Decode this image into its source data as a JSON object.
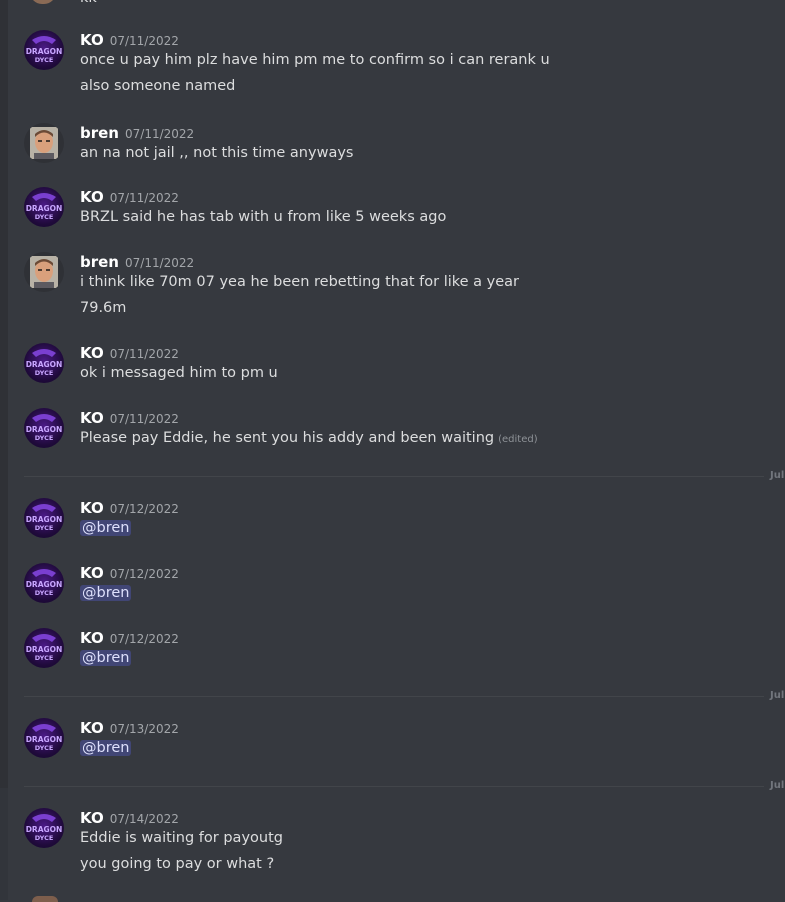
{
  "fragment_top": "kk",
  "messages": [
    {
      "author": "KO",
      "timestamp": "07/11/2022",
      "lines": [
        "once u pay him plz  have him pm me to confirm so i can rerank u",
        "also   someone named"
      ]
    },
    {
      "author": "bren",
      "timestamp": "07/11/2022",
      "lines": [
        "an na not jail ,, not this time anyways"
      ]
    },
    {
      "author": "KO",
      "timestamp": "07/11/2022",
      "lines": [
        "BRZL said he has tab with u from like 5 weeks ago"
      ]
    },
    {
      "author": "bren",
      "timestamp": "07/11/2022",
      "lines": [
        "i think like 70m 07 yea he been rebetting that for like a year",
        "79.6m"
      ]
    },
    {
      "author": "KO",
      "timestamp": "07/11/2022",
      "lines": [
        "ok i messaged him to pm u"
      ]
    },
    {
      "author": "KO",
      "timestamp": "07/11/2022",
      "lines": [
        "Please pay Eddie, he sent you his addy and been waiting"
      ],
      "edited": "(edited)"
    },
    {
      "author": "KO",
      "timestamp": "07/12/2022",
      "mention": "@bren"
    },
    {
      "author": "KO",
      "timestamp": "07/12/2022",
      "mention": "@bren"
    },
    {
      "author": "KO",
      "timestamp": "07/12/2022",
      "mention": "@bren"
    },
    {
      "author": "KO",
      "timestamp": "07/13/2022",
      "mention": "@bren"
    },
    {
      "author": "KO",
      "timestamp": "07/14/2022",
      "lines": [
        "Eddie is waiting for payoutg",
        "you going to pay or what ?"
      ]
    }
  ],
  "dividers": [
    "Jul",
    "Jul",
    "Jul"
  ],
  "avatar_text": {
    "ko_top": "DRAGON",
    "ko_bottom": "DYCE"
  },
  "colors": {
    "background": "#36393f",
    "mention_bg": "#414675",
    "ko_avatar": "#4b1a86"
  }
}
